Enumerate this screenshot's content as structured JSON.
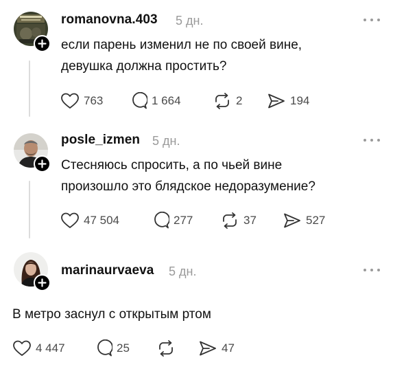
{
  "posts": [
    {
      "username": "romanovna.403",
      "time": "5 дн.",
      "text_lines": [
        "если парень изменил не по своей вине,",
        "девушка должна простить?"
      ],
      "stats": {
        "likes": "763",
        "replies": "1 664",
        "reposts": "2",
        "shares": "194"
      },
      "avatar_label": "profile photo"
    },
    {
      "username": "posle_izmen",
      "time": "5 дн.",
      "text_lines": [
        "Стесняюсь спросить, а по чьей вине",
        "произошло это блядское недоразумение?"
      ],
      "stats": {
        "likes": "47 504",
        "replies": "277",
        "reposts": "37",
        "shares": "527"
      },
      "avatar_label": "profile photo"
    },
    {
      "username": "marinaurvaeva",
      "time": "5 дн.",
      "text_lines": [
        "В метро заснул с открытым ртом"
      ],
      "stats": {
        "likes": "4 447",
        "replies": "25",
        "reposts": "",
        "shares": "47"
      },
      "avatar_label": "profile photo"
    }
  ],
  "icons": {
    "like": "heart-icon",
    "reply": "comment-bubble-icon",
    "repost": "repost-arrows-icon",
    "share": "send-arrow-icon",
    "more": "more-dots-icon",
    "follow": "plus-icon"
  },
  "colors": {
    "text": "#111111",
    "muted": "#9a9a9a",
    "icon": "#333333",
    "badge": "#000000",
    "thread_line": "#dcdcdc"
  }
}
